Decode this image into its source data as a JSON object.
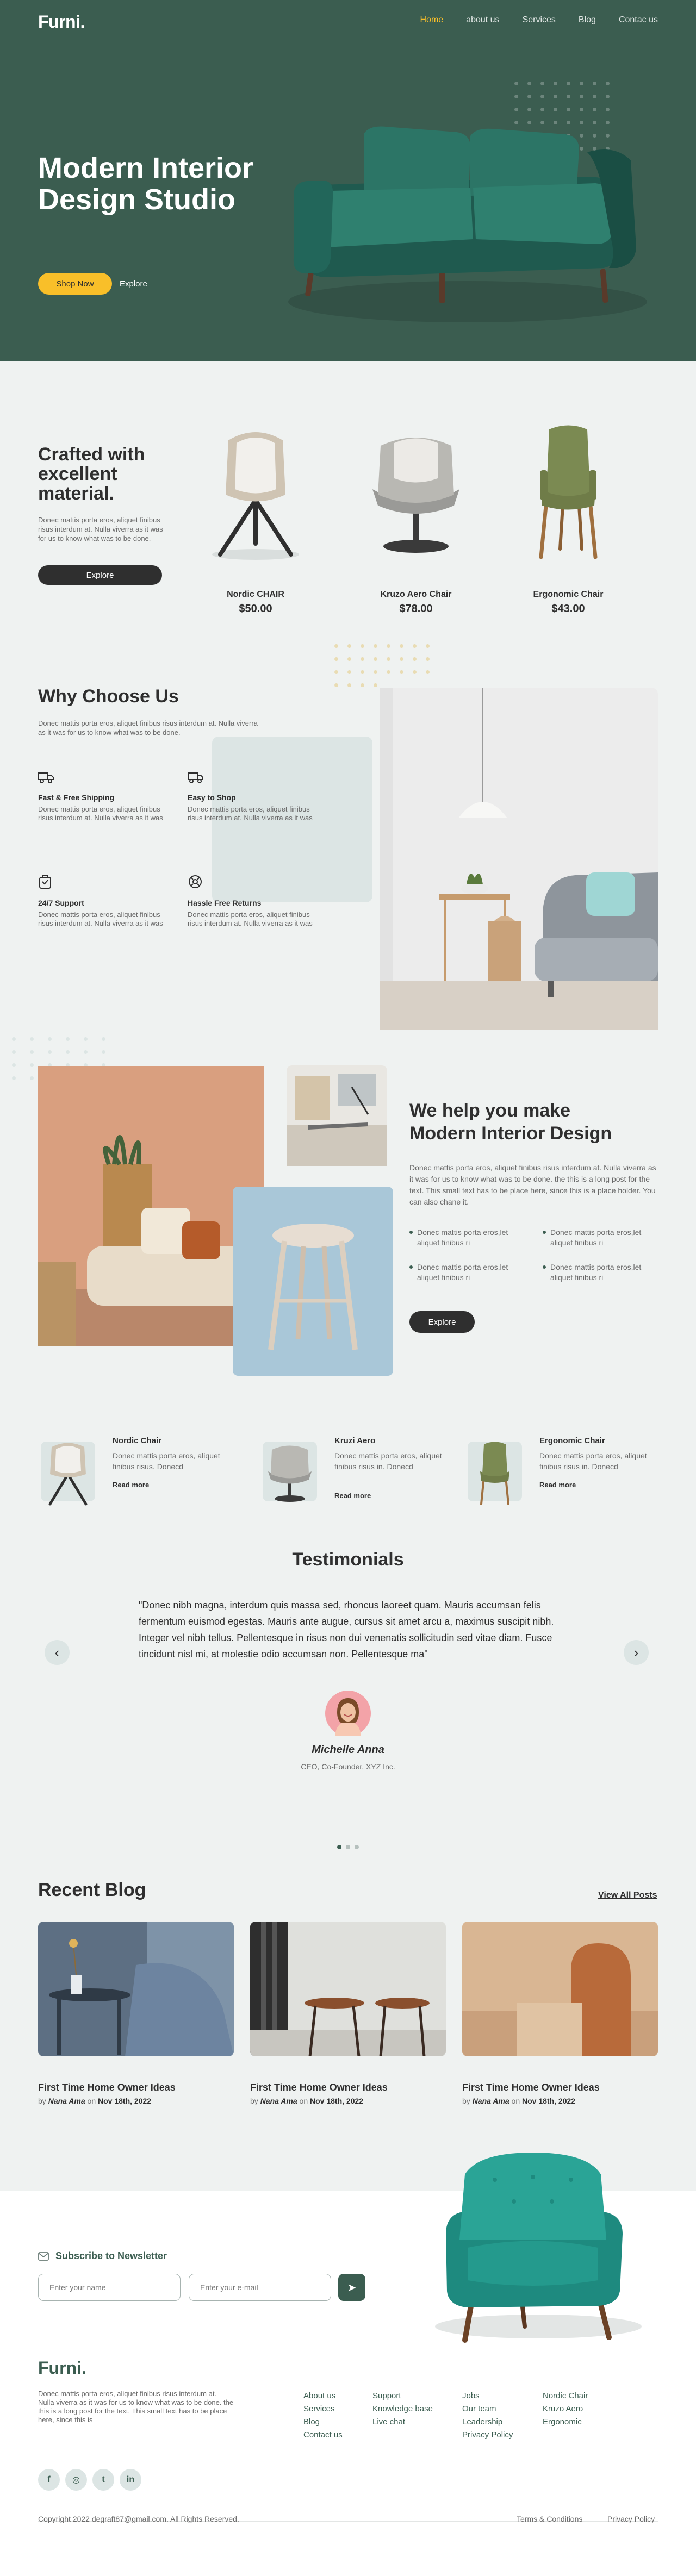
{
  "brand": "Furni.",
  "nav": {
    "home": "Home",
    "about": "about us",
    "services": "Services",
    "blog": "Blog",
    "contact": "Contac us"
  },
  "hero": {
    "title": "Modern Interior Design Studio",
    "shop_now": "Shop Now",
    "explore": "Explore"
  },
  "crafted": {
    "title": "Crafted with excellent material.",
    "text": "Donec mattis porta eros, aliquet finibus risus interdum at. Nulla viverra as it was for us to know what was to be done.",
    "button": "Explore",
    "products": [
      {
        "name": "Nordic CHAIR",
        "price": "$50.00"
      },
      {
        "name": "Kruzo Aero Chair",
        "price": "$78.00"
      },
      {
        "name": "Ergonomic Chair",
        "price": "$43.00"
      }
    ]
  },
  "why": {
    "title": "Why Choose Us",
    "text": "Donec mattis porta eros, aliquet finibus risus interdum at. Nulla viverra as it was for us to know what was to be done.",
    "features": [
      {
        "title": "Fast & Free Shipping",
        "text": "Donec mattis porta eros, aliquet finibus risus interdum at. Nulla viverra as it was"
      },
      {
        "title": "Easy to Shop",
        "text": "Donec mattis porta eros, aliquet finibus risus interdum at. Nulla viverra as it was"
      },
      {
        "title": "24/7 Support",
        "text": "Donec mattis porta eros, aliquet finibus risus interdum at. Nulla viverra as it was"
      },
      {
        "title": "Hassle Free Returns",
        "text": "Donec mattis porta eros, aliquet finibus risus interdum at. Nulla viverra as it was"
      }
    ]
  },
  "help": {
    "title": "We help you make Modern Interior Design",
    "text": "Donec mattis porta eros, aliquet finibus risus interdum at. Nulla viverra as it was for us to know what was to be done. the this is a long post for the text. This small text has to be place here, since this is a place holder. You can also chane it.",
    "checks": [
      "Donec mattis porta eros,let aliquet finibus ri",
      "Donec mattis porta eros,let aliquet finibus ri",
      "Donec mattis porta eros,let aliquet finibus ri",
      "Donec mattis porta eros,let aliquet finibus ri"
    ],
    "button": "Explore"
  },
  "small_products": [
    {
      "name": "Nordic Chair",
      "text": "Donec mattis porta eros, aliquet finibus risus. Donecd",
      "more": "Read more"
    },
    {
      "name": "Kruzi Aero",
      "text": "Donec mattis porta eros, aliquet finibus risus in. Donecd",
      "more": "Read more"
    },
    {
      "name": "Ergonomic Chair",
      "text": "Donec mattis porta eros, aliquet finibus risus in. Donecd",
      "more": "Read more"
    }
  ],
  "testimonials": {
    "title": "Testimonials",
    "quote": "\"Donec nibh magna, interdum quis massa sed, rhoncus laoreet quam. Mauris accumsan felis fermentum euismod egestas. Mauris ante augue, cursus sit amet arcu a, maximus suscipit nibh. Integer vel nibh tellus. Pellentesque in risus non dui venenatis sollicitudin sed vitae diam. Fusce tincidunt nisl mi, at molestie odio accumsan non. Pellentesque ma\"",
    "name": "Michelle Anna",
    "role": "CEO, Co-Founder, XYZ Inc.",
    "prev": "‹",
    "next": "›"
  },
  "blog": {
    "title": "Recent Blog",
    "view_all": "View All Posts",
    "posts": [
      {
        "title": "First Time Home Owner Ideas",
        "by": "by",
        "author": "Nana Ama",
        "on": "on",
        "date": "Nov 18th, 2022"
      },
      {
        "title": "First Time Home Owner Ideas",
        "by": "by",
        "author": "Nana Ama",
        "on": "on",
        "date": "Nov 18th, 2022"
      },
      {
        "title": "First Time Home Owner Ideas",
        "by": "by",
        "author": "Nana Ama",
        "on": "on",
        "date": "Nov 18th, 2022"
      }
    ]
  },
  "newsletter": {
    "title": "Subscribe to Newsletter",
    "name_placeholder": "Enter your name",
    "email_placeholder": "Enter your e-mail",
    "send": "➤"
  },
  "footer": {
    "brand": "Furni.",
    "text": "Donec mattis porta eros, aliquet finibus risus interdum at. Nulla viverra as it was for us to know what was to be done. the this is a long post for the text. This small text has to be place here, since this is",
    "col1": [
      "About us",
      "Services",
      "Blog",
      "Contact us"
    ],
    "col2": [
      "Support",
      "Knowledge base",
      "Live chat"
    ],
    "col3": [
      "Jobs",
      "Our team",
      "Leadership",
      "Privacy Policy"
    ],
    "col4": [
      "Nordic Chair",
      "Kruzo Aero",
      "Ergonomic"
    ],
    "social": [
      "f",
      "◎",
      "t",
      "in"
    ],
    "copyright": "Copyright 2022 degraft87@gmail.com. All Rights Reserved.",
    "terms": "Terms & Conditions",
    "privacy": "Privacy Policy"
  },
  "colors": {
    "green": "#3b5d50",
    "yellow": "#f9bf29",
    "background": "#eff2f1",
    "dark": "#2f2f2f"
  }
}
